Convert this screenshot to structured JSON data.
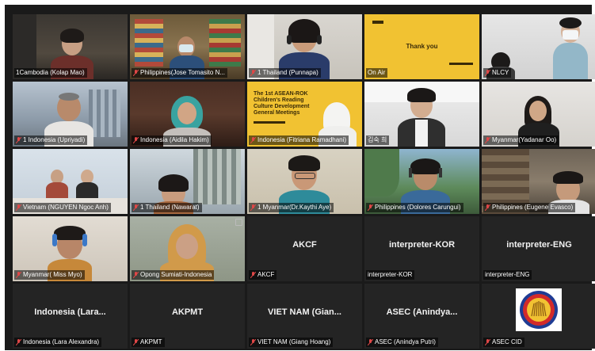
{
  "colors": {
    "muted_mic": "#e04747",
    "tile_bg": "#232323",
    "highlight": "#d8d04a",
    "slide_yellow": "#f1c232"
  },
  "tiles": [
    {
      "label": "1Cambodia (Kolap Mao)"
    },
    {
      "label": "Philippines(Jose Tomasito N..."
    },
    {
      "label": "1 Thailand (Punnapa)"
    },
    {
      "label": "On Air",
      "slide_text": "Thank you"
    },
    {
      "label": "NLCY"
    },
    {
      "label": "1 Indonesia (Upriyadi)"
    },
    {
      "label": "Indonesia (Aidila Hakim)"
    },
    {
      "label": "Indonesia (Fitriana Ramadhani)",
      "slide_text": "The 1st ASEAN-ROK Children's Reading Culture Development General Meetings"
    },
    {
      "label": "김숙 희"
    },
    {
      "label": "Myanmar(Yadanar Oo)"
    },
    {
      "label": "Vietnam (NGUYEN Ngoc Anh)"
    },
    {
      "label": "1 Thailand (Nawarat)"
    },
    {
      "label": "1 Myanmar(Dr.Kaythi Aye)"
    },
    {
      "label": "Philippines (Dolores Carungui)"
    },
    {
      "label": "Philippines (Eugene Evasco)"
    },
    {
      "label": "Myanmar( Miss Myo)"
    },
    {
      "label": "Opong Sumiati-Indonesia"
    },
    {
      "label": "AKCF",
      "name": "AKCF"
    },
    {
      "label": "interpreter-KOR",
      "name": "interpreter-KOR"
    },
    {
      "label": "interpreter-ENG",
      "name": "interpreter-ENG"
    },
    {
      "label": "Indonesia (Lara Alexandra)",
      "name": "Indonesia  (Lara..."
    },
    {
      "label": "AKPMT",
      "name": "AKPMT"
    },
    {
      "label": "VIET NAM (Giang Hoang)",
      "name": "VIET NAM (Gian..."
    },
    {
      "label": "ASEC (Anindya Putri)",
      "name": "ASEC  (Anindya..."
    },
    {
      "label": "ASEC CID"
    }
  ]
}
